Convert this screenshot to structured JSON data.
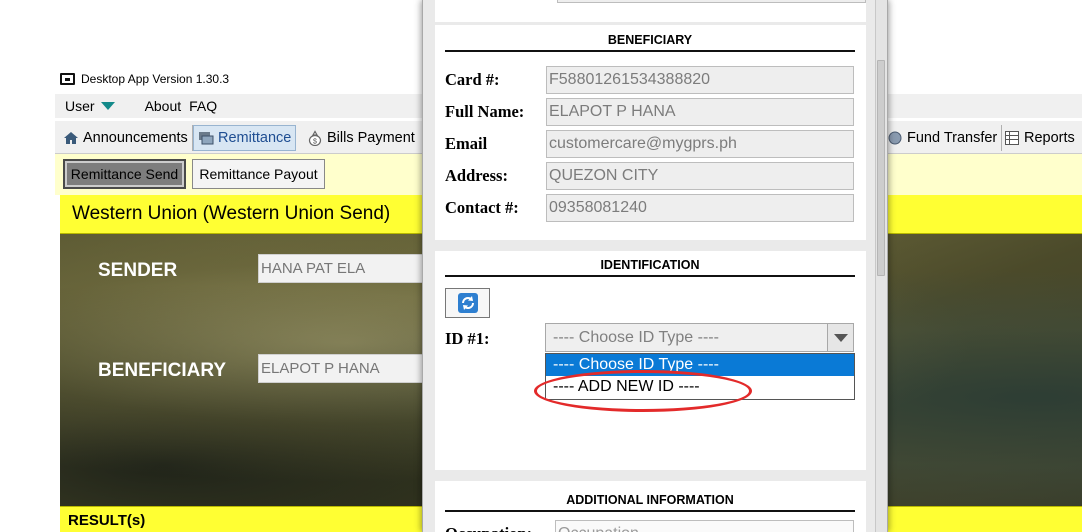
{
  "app": {
    "title": "Desktop App Version 1.30.3",
    "icon": "window-icon"
  },
  "menu": {
    "user": "User",
    "about": "About",
    "faq": "FAQ"
  },
  "tabs": {
    "announcements": "Announcements",
    "remittance": "Remittance",
    "bills_payment": "Bills Payment",
    "fund_transfer": "Fund Transfer",
    "reports": "Reports"
  },
  "subtabs": {
    "send": "Remittance Send",
    "payout": "Remittance Payout"
  },
  "main": {
    "header": "Western Union (Western Union Send)",
    "sender_label": "SENDER",
    "sender_value": "HANA PAT ELA",
    "beneficiary_label": "BENEFICIARY",
    "beneficiary_value": "ELAPOT P HANA",
    "result_label": "RESULT(s)"
  },
  "dialog": {
    "beneficiary": {
      "title": "BENEFICIARY",
      "fields": [
        {
          "label": "Card #:",
          "value": "F58801261534388820"
        },
        {
          "label": "Full Name:",
          "value": "ELAPOT P HANA"
        },
        {
          "label": "Email",
          "value": "customercare@mygprs.ph"
        },
        {
          "label": "Address:",
          "value": "QUEZON CITY"
        },
        {
          "label": "Contact #:",
          "value": "09358081240"
        }
      ]
    },
    "identification": {
      "title": "IDENTIFICATION",
      "id_label": "ID #1:",
      "selected": "---- Choose ID Type ----",
      "options": [
        "---- Choose ID Type ----",
        "---- ADD NEW ID ----"
      ]
    },
    "additional": {
      "title": "ADDITIONAL INFORMATION",
      "occupation_label": "Occupation:",
      "occupation_placeholder": "Occupation"
    }
  },
  "colors": {
    "header_yellow": "#ffff33",
    "selected_option": "#0a7ad6",
    "annotation": "#e32a2a"
  }
}
